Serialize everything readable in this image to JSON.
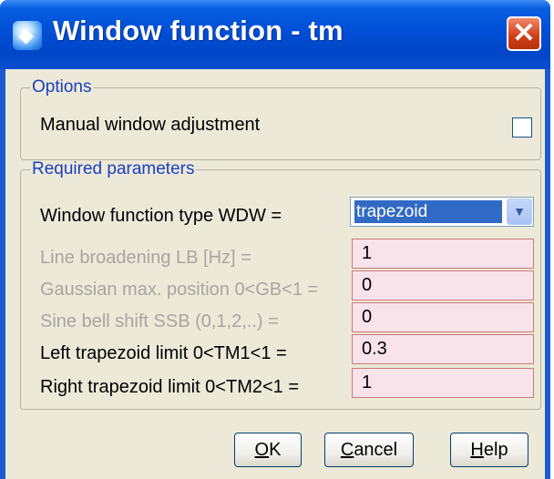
{
  "window": {
    "title": "Window function - tm",
    "title_icon": "app-icon",
    "close_icon": "close-icon",
    "close_glyph": "✕"
  },
  "options": {
    "legend": "Options",
    "manual_label": "Manual window adjustment",
    "manual_checked": false
  },
  "params": {
    "legend": "Required parameters",
    "wdw_label": "Window function type WDW =",
    "wdw_value": "trapezoid",
    "rows": [
      {
        "label": "Line broadening LB [Hz] =",
        "value": "1",
        "enabled": false
      },
      {
        "label": "Gaussian max. position 0<GB<1 =",
        "value": "0",
        "enabled": false
      },
      {
        "label": "Sine bell shift SSB (0,1,2,..) =",
        "value": "0",
        "enabled": false
      },
      {
        "label": "Left trapezoid limit 0<TM1<1 =",
        "value": "0.3",
        "enabled": true
      },
      {
        "label": "Right trapezoid limit 0<TM2<1 =",
        "value": "1",
        "enabled": true
      }
    ]
  },
  "buttons": {
    "ok_mnemonic": "O",
    "ok_rest": "K",
    "cancel_mnemonic": "C",
    "cancel_rest": "ancel",
    "help_mnemonic": "H",
    "help_rest": "elp"
  }
}
